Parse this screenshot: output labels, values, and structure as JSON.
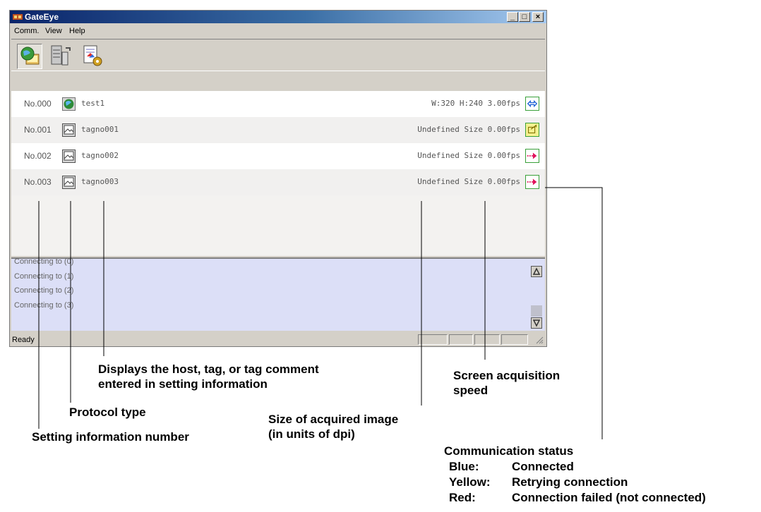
{
  "window": {
    "title": "GateEye",
    "menu": [
      "Comm.",
      "View",
      "Help"
    ],
    "controls": {
      "minimize": "_",
      "maximize": "□",
      "close": "×"
    }
  },
  "toolbar": {
    "buttons": [
      {
        "icon": "connect-globe-icon",
        "pressed": true
      },
      {
        "icon": "server-settings-icon",
        "pressed": false
      },
      {
        "icon": "document-settings-icon",
        "pressed": false
      }
    ]
  },
  "rows": [
    {
      "no": "No.000",
      "protocol_icon": "globe-icon",
      "name": "test1",
      "info": "W:320 H:240 3.00fps",
      "status": "connected",
      "status_color": "#1a5fd6"
    },
    {
      "no": "No.001",
      "protocol_icon": "image-icon",
      "name": "tagno001",
      "info": "Undefined Size 0.00fps",
      "status": "retrying",
      "status_color": "#c7b400"
    },
    {
      "no": "No.002",
      "protocol_icon": "image-icon",
      "name": "tagno002",
      "info": "Undefined Size 0.00fps",
      "status": "failed",
      "status_color": "#e0105a"
    },
    {
      "no": "No.003",
      "protocol_icon": "image-icon",
      "name": "tagno003",
      "info": "Undefined Size 0.00fps",
      "status": "failed",
      "status_color": "#e0105a"
    }
  ],
  "log": [
    "Connecting to (0)",
    "Connecting to (1)",
    "Connecting to (2)",
    "Connecting to (3)"
  ],
  "statusbar": {
    "text": "Ready"
  },
  "callouts": {
    "host_tag": "Displays the host, tag, or tag comment\nentered in setting information",
    "speed": "Screen acquisition\nspeed",
    "protocol": "Protocol type",
    "size": "Size of acquired image\n(in units of dpi)",
    "setting_no": "Setting information number",
    "comm_title": "Communication status",
    "legend": [
      {
        "label": "Blue:",
        "value": "Connected"
      },
      {
        "label": "Yellow:",
        "value": "Retrying connection"
      },
      {
        "label": "Red:",
        "value": "Connection failed (not connected)"
      }
    ]
  }
}
